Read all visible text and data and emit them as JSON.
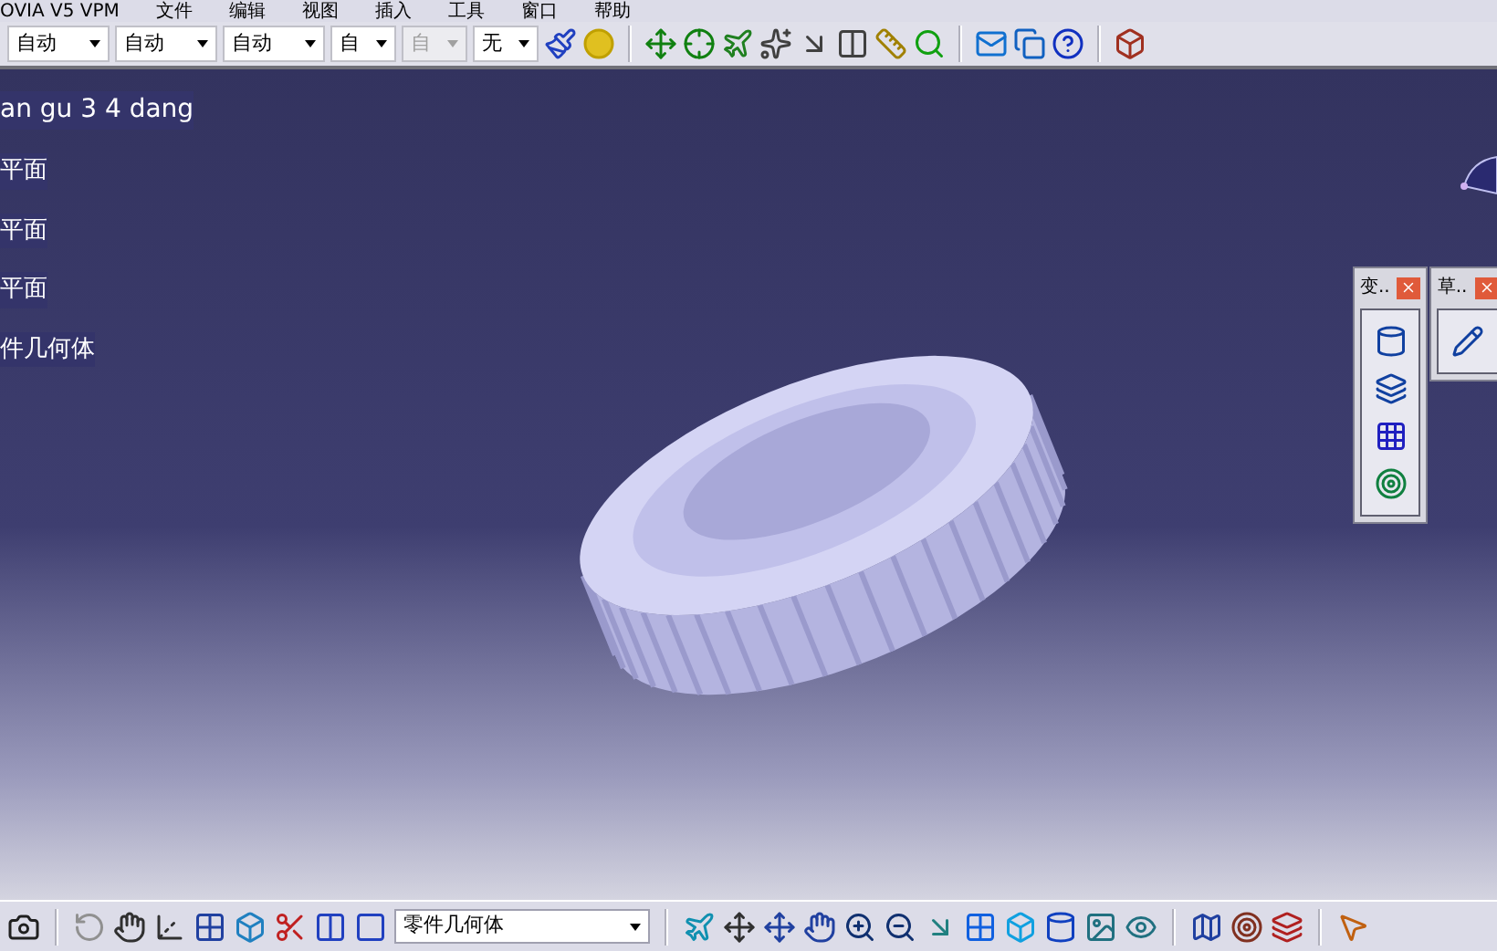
{
  "menu_bar": {
    "items": [
      "OVIA V5 VPM",
      "文件",
      "编辑",
      "视图",
      "插入",
      "工具",
      "窗口",
      "帮助"
    ]
  },
  "toolbar": {
    "dropdowns": [
      {
        "value": "自动",
        "disabled": false
      },
      {
        "value": "自动",
        "disabled": false
      },
      {
        "value": "自动",
        "disabled": false
      },
      {
        "value": "自",
        "disabled": false
      },
      {
        "value": "自",
        "disabled": true
      },
      {
        "value": "无",
        "disabled": false
      }
    ]
  },
  "tree": {
    "label": "an gu 3 4 dang",
    "children": [
      {
        "label": "平面"
      },
      {
        "label": "平面"
      },
      {
        "label": "平面"
      },
      {
        "label": "件几何体"
      }
    ]
  },
  "floating_toolbars": [
    {
      "title": "变.."
    },
    {
      "title": "草.."
    }
  ],
  "bottom_toolbar": {
    "body_selector": {
      "value": "零件几何体"
    }
  }
}
